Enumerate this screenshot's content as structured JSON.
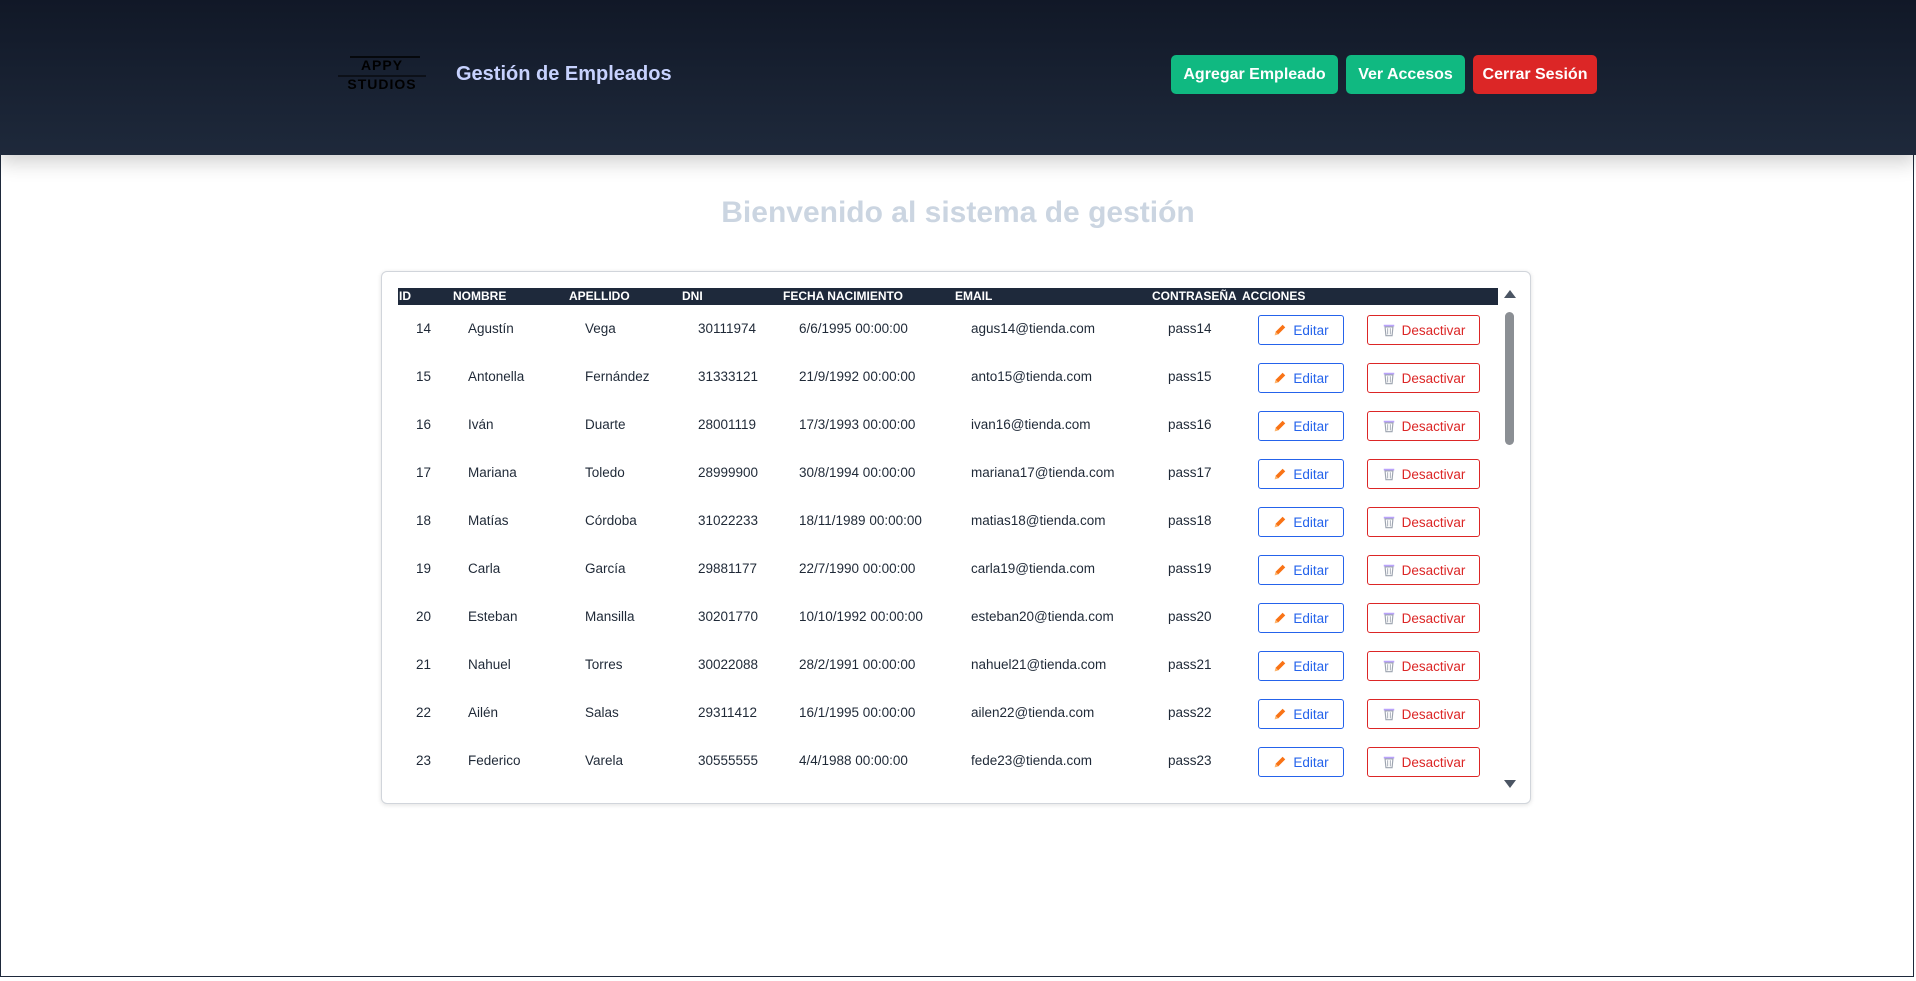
{
  "header": {
    "logo_text_top": "APPY",
    "logo_text_bottom": "STUDIOS",
    "title": "Gestión de Empleados",
    "buttons": {
      "add_employee": "Agregar Empleado",
      "view_access": "Ver Accesos",
      "logout": "Cerrar Sesión"
    }
  },
  "main": {
    "welcome": "Bienvenido al sistema de gestión"
  },
  "table": {
    "columns": [
      "ID",
      "NOMBRE",
      "APELLIDO",
      "DNI",
      "FECHA NACIMIENTO",
      "EMAIL",
      "CONTRASEÑA",
      "ACCIONES"
    ],
    "edit_label": "Editar",
    "deactivate_label": "Desactivar",
    "rows": [
      {
        "id": "14",
        "nombre": "Agustín",
        "apellido": "Vega",
        "dni": "30111974",
        "fecha": "6/6/1995 00:00:00",
        "email": "agus14@tienda.com",
        "pass": "pass14"
      },
      {
        "id": "15",
        "nombre": "Antonella",
        "apellido": "Fernández",
        "dni": "31333121",
        "fecha": "21/9/1992 00:00:00",
        "email": "anto15@tienda.com",
        "pass": "pass15"
      },
      {
        "id": "16",
        "nombre": "Iván",
        "apellido": "Duarte",
        "dni": "28001119",
        "fecha": "17/3/1993 00:00:00",
        "email": "ivan16@tienda.com",
        "pass": "pass16"
      },
      {
        "id": "17",
        "nombre": "Mariana",
        "apellido": "Toledo",
        "dni": "28999900",
        "fecha": "30/8/1994 00:00:00",
        "email": "mariana17@tienda.com",
        "pass": "pass17"
      },
      {
        "id": "18",
        "nombre": "Matías",
        "apellido": "Córdoba",
        "dni": "31022233",
        "fecha": "18/11/1989 00:00:00",
        "email": "matias18@tienda.com",
        "pass": "pass18"
      },
      {
        "id": "19",
        "nombre": "Carla",
        "apellido": "García",
        "dni": "29881177",
        "fecha": "22/7/1990 00:00:00",
        "email": "carla19@tienda.com",
        "pass": "pass19"
      },
      {
        "id": "20",
        "nombre": "Esteban",
        "apellido": "Mansilla",
        "dni": "30201770",
        "fecha": "10/10/1992 00:00:00",
        "email": "esteban20@tienda.com",
        "pass": "pass20"
      },
      {
        "id": "21",
        "nombre": "Nahuel",
        "apellido": "Torres",
        "dni": "30022088",
        "fecha": "28/2/1991 00:00:00",
        "email": "nahuel21@tienda.com",
        "pass": "pass21"
      },
      {
        "id": "22",
        "nombre": "Ailén",
        "apellido": "Salas",
        "dni": "29311412",
        "fecha": "16/1/1995 00:00:00",
        "email": "ailen22@tienda.com",
        "pass": "pass22"
      },
      {
        "id": "23",
        "nombre": "Federico",
        "apellido": "Varela",
        "dni": "30555555",
        "fecha": "4/4/1988 00:00:00",
        "email": "fede23@tienda.com",
        "pass": "pass23"
      }
    ]
  },
  "icons": {
    "edit": "pencil-icon",
    "deactivate": "trash-icon"
  },
  "colors": {
    "header_bg": "#111827",
    "primary_green": "#10b981",
    "danger_red": "#dc2626",
    "edit_blue": "#2563eb",
    "pencil_orange": "#f97316"
  }
}
